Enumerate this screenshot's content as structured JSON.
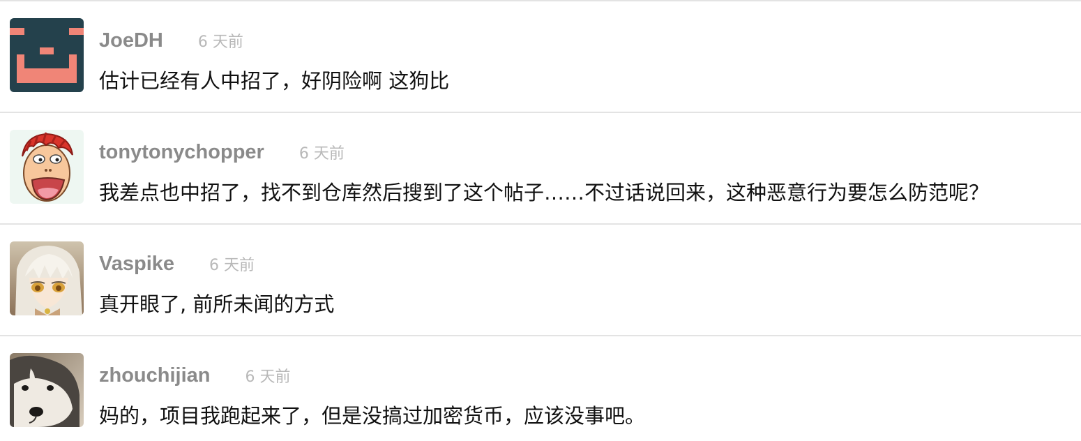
{
  "comments": [
    {
      "username": "JoeDH",
      "time": "6 天前",
      "text": "估计已经有人中招了，好阴险啊 这狗比",
      "avatar_icon": "pixel-face-avatar"
    },
    {
      "username": "tonytonychopper",
      "time": "6 天前",
      "text": "我差点也中招了，找不到仓库然后搜到了这个帖子……不过话说回来，这种恶意行为要怎么防范呢？",
      "avatar_icon": "cartoon-face-avatar"
    },
    {
      "username": "Vaspike",
      "time": "6 天前",
      "text": "真开眼了, 前所未闻的方式",
      "avatar_icon": "anime-girl-avatar"
    },
    {
      "username": "zhouchijian",
      "time": "6 天前",
      "text": "妈的，项目我跑起来了，但是没搞过加密货币，应该没事吧。",
      "avatar_icon": "husky-dog-avatar"
    }
  ],
  "colors": {
    "username": "#8a8a8a",
    "timestamp": "#b8b8b8",
    "divider": "#e3e3e3",
    "pixel_avatar_bg": "#24414c",
    "pixel_avatar_fg": "#f08577"
  }
}
